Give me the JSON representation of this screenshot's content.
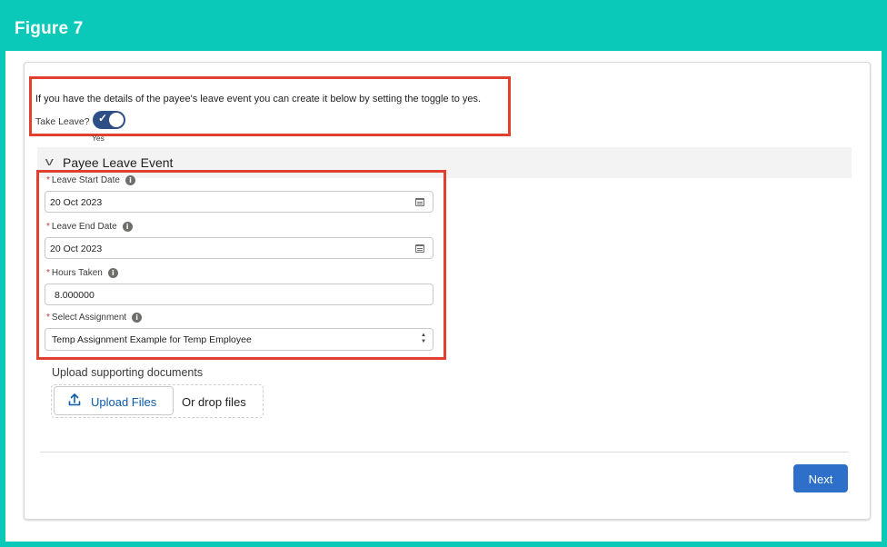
{
  "figure": {
    "title": "Figure 7"
  },
  "intro": {
    "text": "If you have the details of the payee's leave event you can create it below by setting the toggle to yes.",
    "toggle_label": "Take Leave?",
    "toggle_state": "Yes",
    "toggle_on": true
  },
  "section": {
    "title": "Payee Leave Event"
  },
  "fields": [
    {
      "label": "Leave Start Date",
      "required": true,
      "value": "20 Oct 2023",
      "icon": "calendar-icon"
    },
    {
      "label": "Leave End Date",
      "required": true,
      "value": "20 Oct 2023",
      "icon": "calendar-icon"
    },
    {
      "label": "Hours Taken",
      "required": true,
      "value": "8.000000"
    },
    {
      "label": "Select Assignment",
      "required": true,
      "value": "Temp Assignment Example for Temp Employee"
    }
  ],
  "upload": {
    "label": "Upload supporting documents",
    "button_label": "Upload Files",
    "drop_text": "Or drop files"
  },
  "footer": {
    "next_label": "Next"
  },
  "colors": {
    "frame": "#0bc9b9",
    "highlight": "#e0412f",
    "toggle": "#2e4e86",
    "button": "#2e70c9",
    "link": "#0b5cab"
  }
}
